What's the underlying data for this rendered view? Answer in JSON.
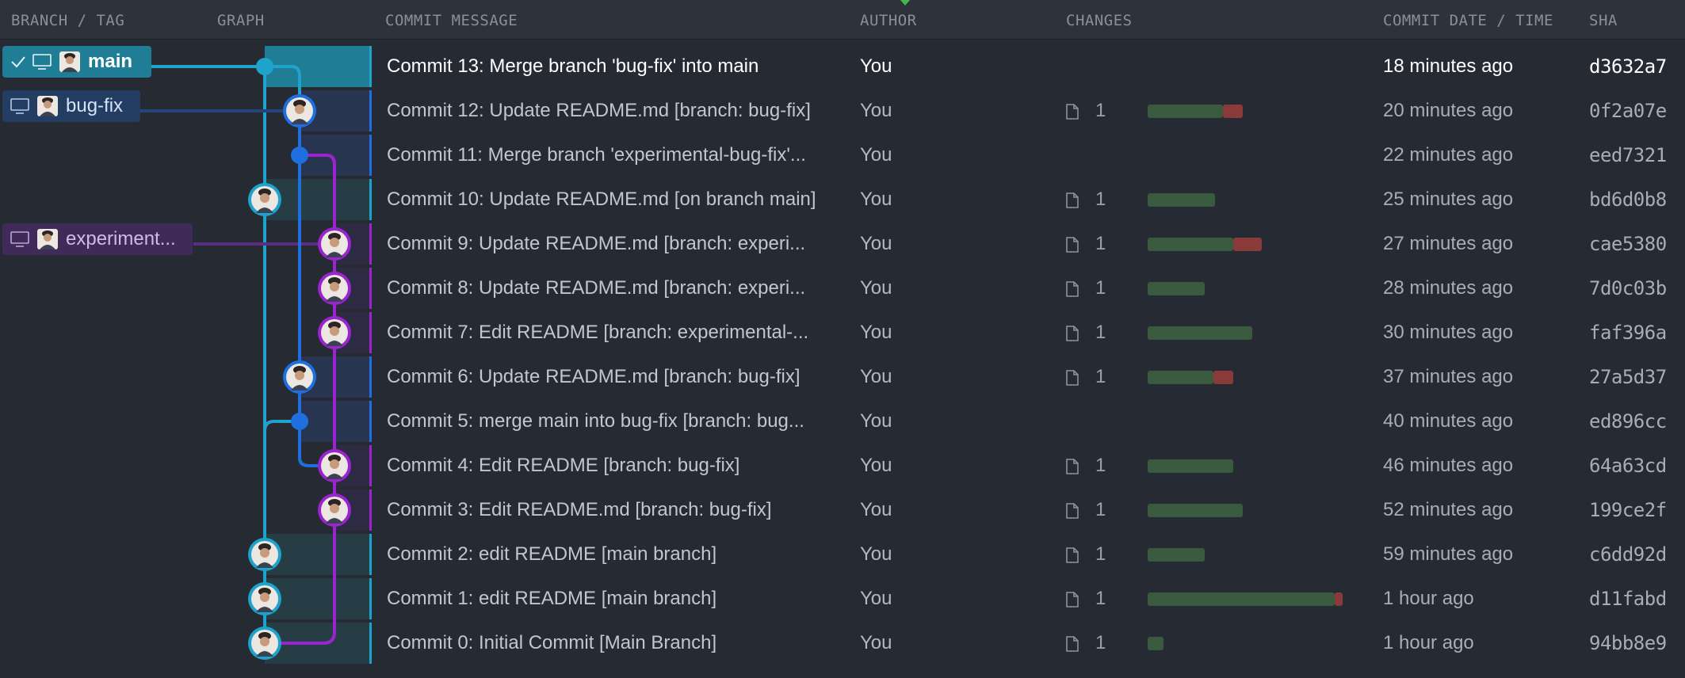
{
  "columns": {
    "branch_tag": "BRANCH / TAG",
    "graph": "GRAPH",
    "commit_message": "COMMIT MESSAGE",
    "author": "AUTHOR",
    "changes": "CHANGES",
    "commit_date": "COMMIT DATE / TIME",
    "sha": "SHA"
  },
  "refs": [
    {
      "name": "main",
      "checked_out": true,
      "color": "#1f7e95"
    },
    {
      "name": "bug-fix",
      "checked_out": false,
      "color": "#233d63"
    },
    {
      "name": "experiment...",
      "checked_out": false,
      "color": "#3f2a5a"
    }
  ],
  "colors": {
    "main_lane": "#1ea3cc",
    "bugfix_lane": "#1f6fe0",
    "experimental_lane": "#9a24d0",
    "additions": "#3a5a40",
    "deletions": "#8b3a3a"
  },
  "commits": [
    {
      "message": "Commit 13: Merge branch 'bug-fix' into main",
      "author": "You",
      "files": "",
      "added": 0,
      "deleted": 0,
      "date": "18 minutes ago",
      "sha": "d3632a7",
      "lane": "main",
      "selected": true
    },
    {
      "message": "Commit 12: Update README.md [branch: bug-fix]",
      "author": "You",
      "files": "1",
      "added": 95,
      "deleted": 25,
      "date": "20 minutes ago",
      "sha": "0f2a07e",
      "lane": "bugfix"
    },
    {
      "message": "Commit 11: Merge branch 'experimental-bug-fix'...",
      "author": "You",
      "files": "",
      "added": 0,
      "deleted": 0,
      "date": "22 minutes ago",
      "sha": "eed7321",
      "lane": "bugfix"
    },
    {
      "message": "Commit 10: Update README.md [on branch main]",
      "author": "You",
      "files": "1",
      "added": 85,
      "deleted": 0,
      "date": "25 minutes ago",
      "sha": "bd6d0b8",
      "lane": "main"
    },
    {
      "message": "Commit 9: Update README.md [branch: experi...",
      "author": "You",
      "files": "1",
      "added": 108,
      "deleted": 36,
      "date": "27 minutes ago",
      "sha": "cae5380",
      "lane": "experimental"
    },
    {
      "message": "Commit 8: Update README.md [branch: experi...",
      "author": "You",
      "files": "1",
      "added": 72,
      "deleted": 0,
      "date": "28 minutes ago",
      "sha": "7d0c03b",
      "lane": "experimental"
    },
    {
      "message": "Commit 7: Edit README [branch: experimental-...",
      "author": "You",
      "files": "1",
      "added": 132,
      "deleted": 0,
      "date": "30 minutes ago",
      "sha": "faf396a",
      "lane": "experimental"
    },
    {
      "message": "Commit 6: Update README.md [branch: bug-fix]",
      "author": "You",
      "files": "1",
      "added": 83,
      "deleted": 25,
      "date": "37 minutes ago",
      "sha": "27a5d37",
      "lane": "bugfix"
    },
    {
      "message": "Commit 5: merge main into bug-fix [branch: bug...",
      "author": "You",
      "files": "",
      "added": 0,
      "deleted": 0,
      "date": "40 minutes ago",
      "sha": "ed896cc",
      "lane": "bugfix"
    },
    {
      "message": "Commit 4: Edit README [branch: bug-fix]",
      "author": "You",
      "files": "1",
      "added": 108,
      "deleted": 0,
      "date": "46 minutes ago",
      "sha": "64a63cd",
      "lane": "experimental"
    },
    {
      "message": "Commit 3: Edit README.md [branch: bug-fix]",
      "author": "You",
      "files": "1",
      "added": 120,
      "deleted": 0,
      "date": "52 minutes ago",
      "sha": "199ce2f",
      "lane": "experimental"
    },
    {
      "message": "Commit 2: edit README [main branch]",
      "author": "You",
      "files": "1",
      "added": 72,
      "deleted": 0,
      "date": "59 minutes ago",
      "sha": "c6dd92d",
      "lane": "main"
    },
    {
      "message": "Commit 1: edit README [main branch]",
      "author": "You",
      "files": "1",
      "added": 236,
      "deleted": 10,
      "date": "1 hour ago",
      "sha": "d11fabd",
      "lane": "main"
    },
    {
      "message": "Commit 0: Initial Commit [Main Branch]",
      "author": "You",
      "files": "1",
      "added": 20,
      "deleted": 0,
      "date": "1 hour ago",
      "sha": "94bb8e9",
      "lane": "main"
    }
  ]
}
